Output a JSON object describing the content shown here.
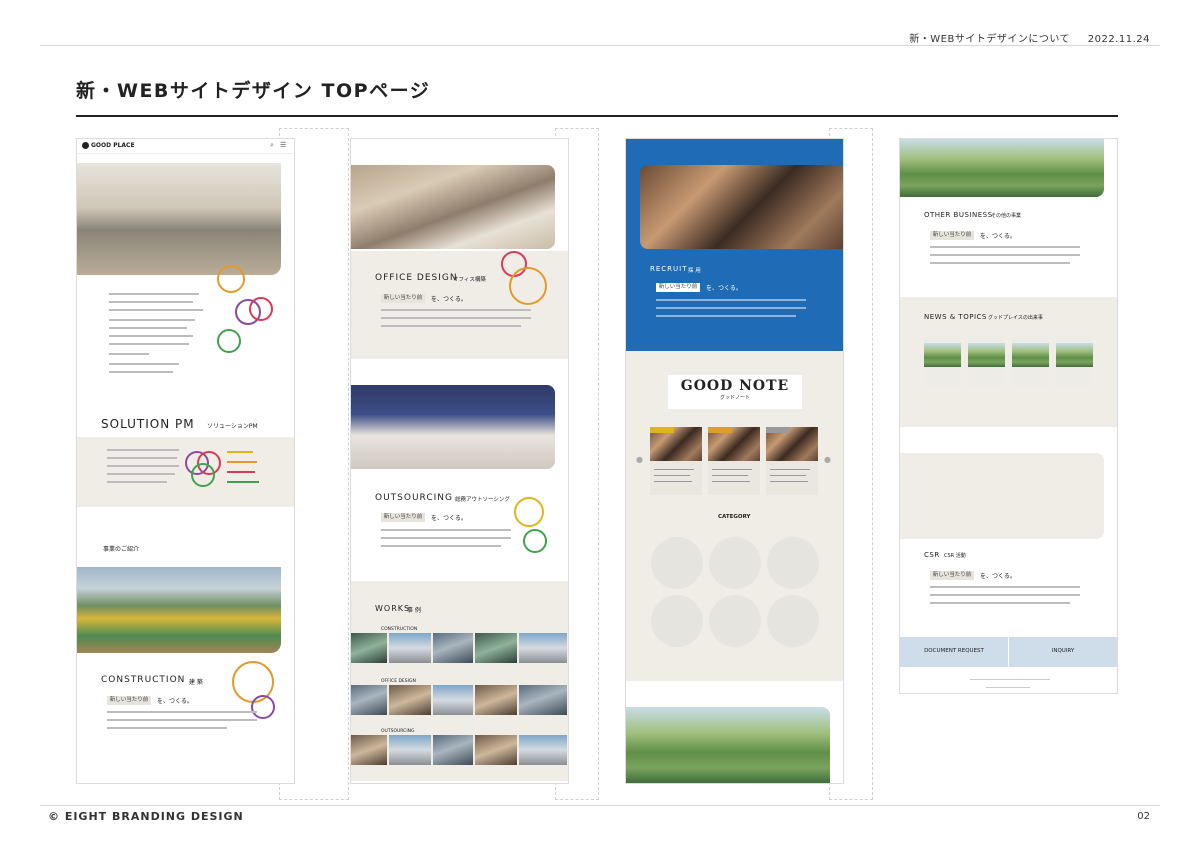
{
  "header": {
    "doc_title": "新・WEBサイトデザインについて",
    "date": "2022.11.24"
  },
  "page": {
    "title": "新・WEBサイトデザイン TOPページ"
  },
  "footer": {
    "copyright": "© EIGHT BRANDING DESIGN",
    "page_number": "02"
  },
  "mockups": {
    "col1": {
      "logo": "GOOD PLACE",
      "solution_title": "SOLUTION PM",
      "solution_sub": "ソリューションPM",
      "business_intro": "事業のご紹介",
      "construction_title": "CONSTRUCTION",
      "construction_sub": "建 築",
      "tagline_pill": "新しい当たり前",
      "tagline_rest": "を、つくる。"
    },
    "col2": {
      "office_title": "OFFICE DESIGN",
      "office_sub": "オフィス構築",
      "outsourcing_title": "OUTSOURCING",
      "outsourcing_sub": "総務アウトソーシング",
      "tagline_pill": "新しい当たり前",
      "tagline_rest": "を、つくる。",
      "works_title": "WORKS",
      "works_sub": "事 例",
      "works_rows": [
        "CONSTRUCTION",
        "OFFICE DESIGN",
        "OUTSOURCING"
      ]
    },
    "col3": {
      "recruit_title": "RECRUIT",
      "recruit_sub": "採 用",
      "tagline_pill": "新しい当たり前",
      "tagline_rest": "を、つくる。",
      "goodnote_title": "GOOD NOTE",
      "goodnote_sub": "グッドノート",
      "category_title": "CATEGORY"
    },
    "col4": {
      "other_title": "OTHER BUSINESS",
      "other_sub": "その他の事業",
      "tagline_pill": "新しい当たり前",
      "tagline_rest": "を、つくる。",
      "news_title": "NEWS & TOPICS",
      "news_sub": "グッドプレイスの出来事",
      "csr_title": "CSR",
      "csr_sub": "CSR 活動",
      "doc_request": "DOCUMENT REQUEST",
      "inquiry": "INQUIRY"
    }
  },
  "colors": {
    "accent_orange": "#e39a2b",
    "accent_green": "#3fa34d",
    "accent_purple": "#8a4aa0",
    "accent_red": "#d83a5a",
    "accent_yellow": "#e0b51c",
    "recruit_blue": "#1f6bb6",
    "doc_request_bg": "#cfdcea"
  }
}
